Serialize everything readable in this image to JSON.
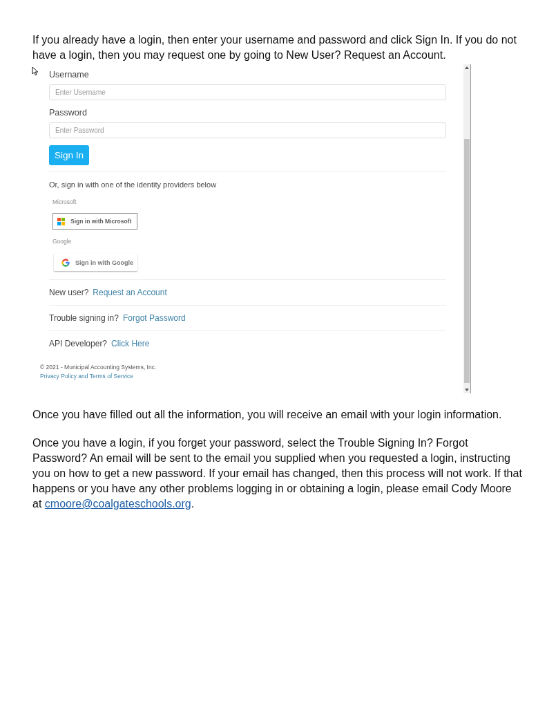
{
  "intro": "If you already have a login, then enter your username and password and click Sign In. If you do not have a login, then you may request one by going to New User? Request an Account.",
  "login_screenshot": {
    "fields": [
      {
        "label": "Username",
        "placeholder": "Enter Username"
      },
      {
        "label": "Password",
        "placeholder": "Enter Password"
      }
    ],
    "sign_in_button": "Sign In",
    "providers_heading": "Or, sign in with one of the identity providers below",
    "providers": [
      {
        "kind": "microsoft",
        "label": "Microsoft",
        "button": "Sign in with Microsoft"
      },
      {
        "kind": "google",
        "label": "Google",
        "button": "Sign in with Google"
      }
    ],
    "links": [
      {
        "prompt": "New user?",
        "link": "Request an Account"
      },
      {
        "prompt": "Trouble signing in?",
        "link": "Forgot Password"
      },
      {
        "prompt": "API Developer?",
        "link": "Click Here"
      }
    ],
    "footer": {
      "copyright": "© 2021 - Municipal Accounting Systems, Inc.",
      "policy_link": "Privacy Policy and Terms of Service"
    }
  },
  "confirmation": "Once you have filled out all the information, you will receive an email with your login information.",
  "help": {
    "text": "Once you have a login, if you forget your password, select the Trouble Signing In? Forgot Password? An email will be sent to the email you supplied when you requested a login, instructing you on how to get a new password. If your email has changed, then this process will not work. If that happens or you have any other problems logging in or obtaining a login, please email Cody Moore at",
    "email": "cmoore@coalgateschools.org",
    "end": "."
  }
}
